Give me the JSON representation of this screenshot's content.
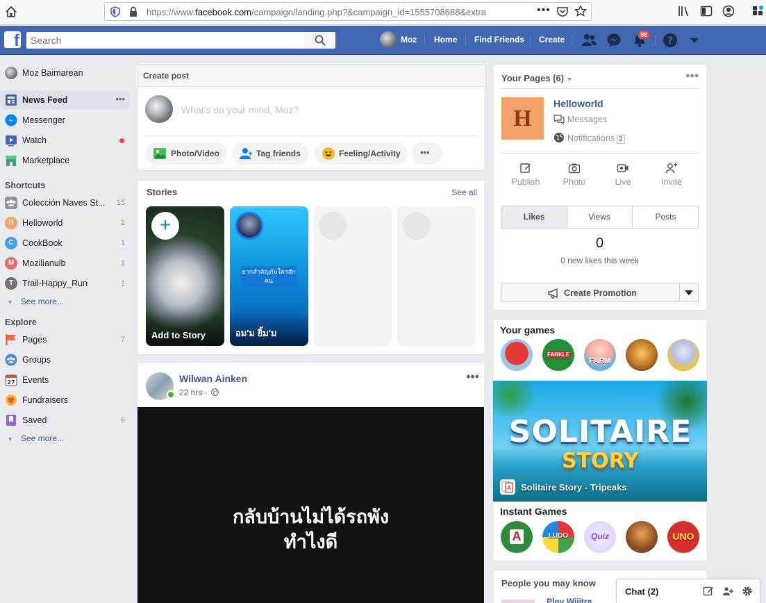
{
  "browser": {
    "url_pre": "https://www.",
    "url_domain": "facebook.com",
    "url_post": "/campaign/landing.php?&campaign_id=1555708688&extra",
    "menu_dots": "•••"
  },
  "topbar": {
    "search_placeholder": "Search",
    "user": "Moz",
    "links": [
      "Home",
      "Find Friends",
      "Create"
    ],
    "notification_count": "98"
  },
  "leftnav": {
    "profile": "Moz Baimarean",
    "main": [
      {
        "label": "News Feed",
        "count": "•••"
      },
      {
        "label": "Messenger",
        "count": ""
      },
      {
        "label": "Watch",
        "count": ""
      },
      {
        "label": "Marketplace",
        "count": ""
      }
    ],
    "shortcuts_heading": "Shortcuts",
    "shortcuts": [
      {
        "label": "Colección Naves St...",
        "count": "15",
        "letter": ""
      },
      {
        "label": "Helloworld",
        "count": "2",
        "letter": "H"
      },
      {
        "label": "CookBook",
        "count": "1",
        "letter": "C"
      },
      {
        "label": "Mozilianulb",
        "count": "1",
        "letter": "M"
      },
      {
        "label": "Trail-Happy_Run",
        "count": "1",
        "letter": "T"
      }
    ],
    "see_more": "See more...",
    "explore_heading": "Explore",
    "explore": [
      {
        "label": "Pages",
        "count": "7"
      },
      {
        "label": "Groups",
        "count": ""
      },
      {
        "label": "Events",
        "count": ""
      },
      {
        "label": "Fundraisers",
        "count": ""
      },
      {
        "label": "Saved",
        "count": "6"
      }
    ],
    "events_day": "27"
  },
  "create_post": {
    "title": "Create post",
    "placeholder": "What's on your mind, Moz?",
    "actions": [
      "Photo/Video",
      "Tag friends",
      "Feeling/Activity"
    ],
    "more": "•••"
  },
  "stories": {
    "title": "Stories",
    "see_all": "See all",
    "items": [
      {
        "name": "Add to Story"
      },
      {
        "name": "อม'ม ยิ้ม'ม",
        "caption": "ยากสำคัญกับใครสักคน"
      }
    ],
    "add_glyph": "+"
  },
  "post": {
    "author": "Wilwan Ainken",
    "time": "22 hrs ·",
    "more": "•••",
    "text_line1": "กลับบ้านไม่ได้รถพัง",
    "text_line2": "ทำไงดี"
  },
  "your_pages": {
    "title": "Your Pages (6)",
    "more": "•••",
    "logo_letter": "H",
    "page_name": "Helloworld",
    "messages": "Messages",
    "notifications": "Notifications",
    "notifications_count": "2",
    "actions": [
      "Publish",
      "Photo",
      "Live",
      "Invite"
    ],
    "tabs": [
      "Likes",
      "Views",
      "Posts"
    ],
    "stat_value": "0",
    "stat_label": "0 new likes this week",
    "promo": "Create Promotion"
  },
  "games": {
    "title": "Your games",
    "icon_labels": [
      "",
      "FARKLE",
      "FARM",
      "",
      ""
    ],
    "banner_title1": "SOLITAIRE",
    "banner_title2": "STORY",
    "banner_caption": "Solitaire Story - Tripeaks",
    "instant_title": "Instant Games",
    "instant_icon_labels": [
      "A",
      "LUDO",
      "Quiz",
      "",
      "UNO"
    ]
  },
  "pymk": {
    "title": "People you may know",
    "name": "Ploy Wijitra"
  },
  "chat": {
    "label": "Chat (2)"
  },
  "colors": {
    "fb_blue": "#4267b2",
    "link_blue": "#365899",
    "red_badge": "#fa3e3e",
    "online_green": "#42b72a"
  }
}
